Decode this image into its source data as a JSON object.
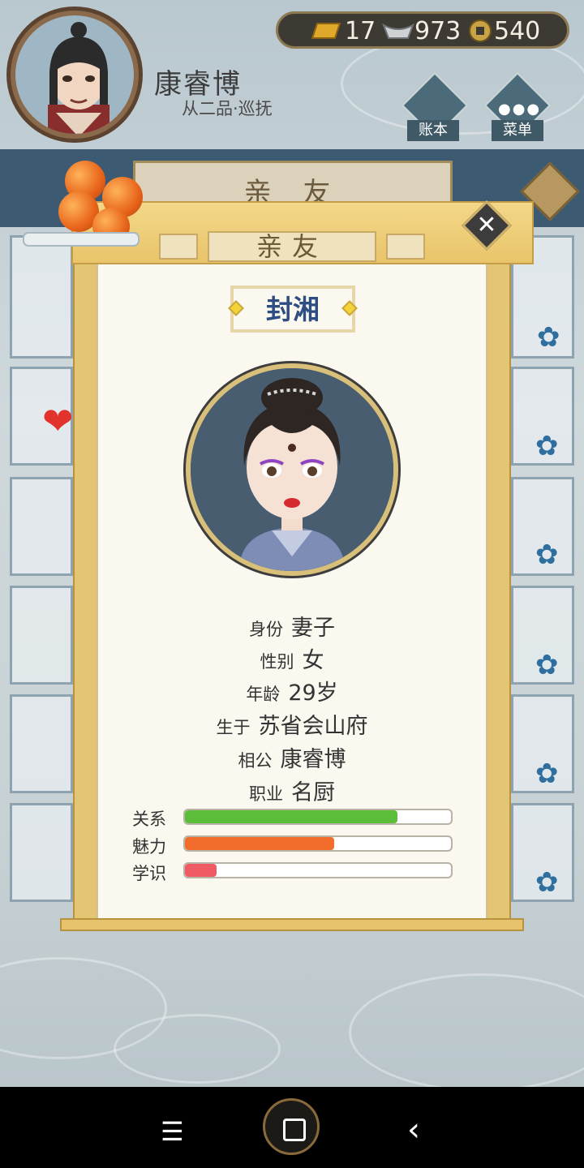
{
  "player": {
    "name": "康睿博",
    "rank": "从二品·巡抚"
  },
  "currency": {
    "gold": "17",
    "silver": "973",
    "coins": "540"
  },
  "top_buttons": {
    "ledger_label": "账本",
    "menu_label": "菜单"
  },
  "background_page": {
    "title": "亲 友"
  },
  "modal": {
    "title": "亲友",
    "close_symbol": "✕",
    "character_name": "封湘",
    "info": [
      {
        "key": "身份",
        "value": "妻子"
      },
      {
        "key": "性别",
        "value": "女"
      },
      {
        "key": "年龄",
        "value": "29岁"
      },
      {
        "key": "生于",
        "value": "苏省会山府"
      },
      {
        "key": "相公",
        "value": "康睿博"
      },
      {
        "key": "职业",
        "value": "名厨"
      }
    ],
    "stats": [
      {
        "label": "关系",
        "level": 0.8,
        "color": "#5cbd3a"
      },
      {
        "label": "魅力",
        "level": 0.56,
        "color": "#f26c2b"
      },
      {
        "label": "学识",
        "level": 0.12,
        "color": "#ef5a63"
      }
    ]
  },
  "navbar": {
    "menu_symbol": "☰",
    "back_symbol": "‹"
  }
}
